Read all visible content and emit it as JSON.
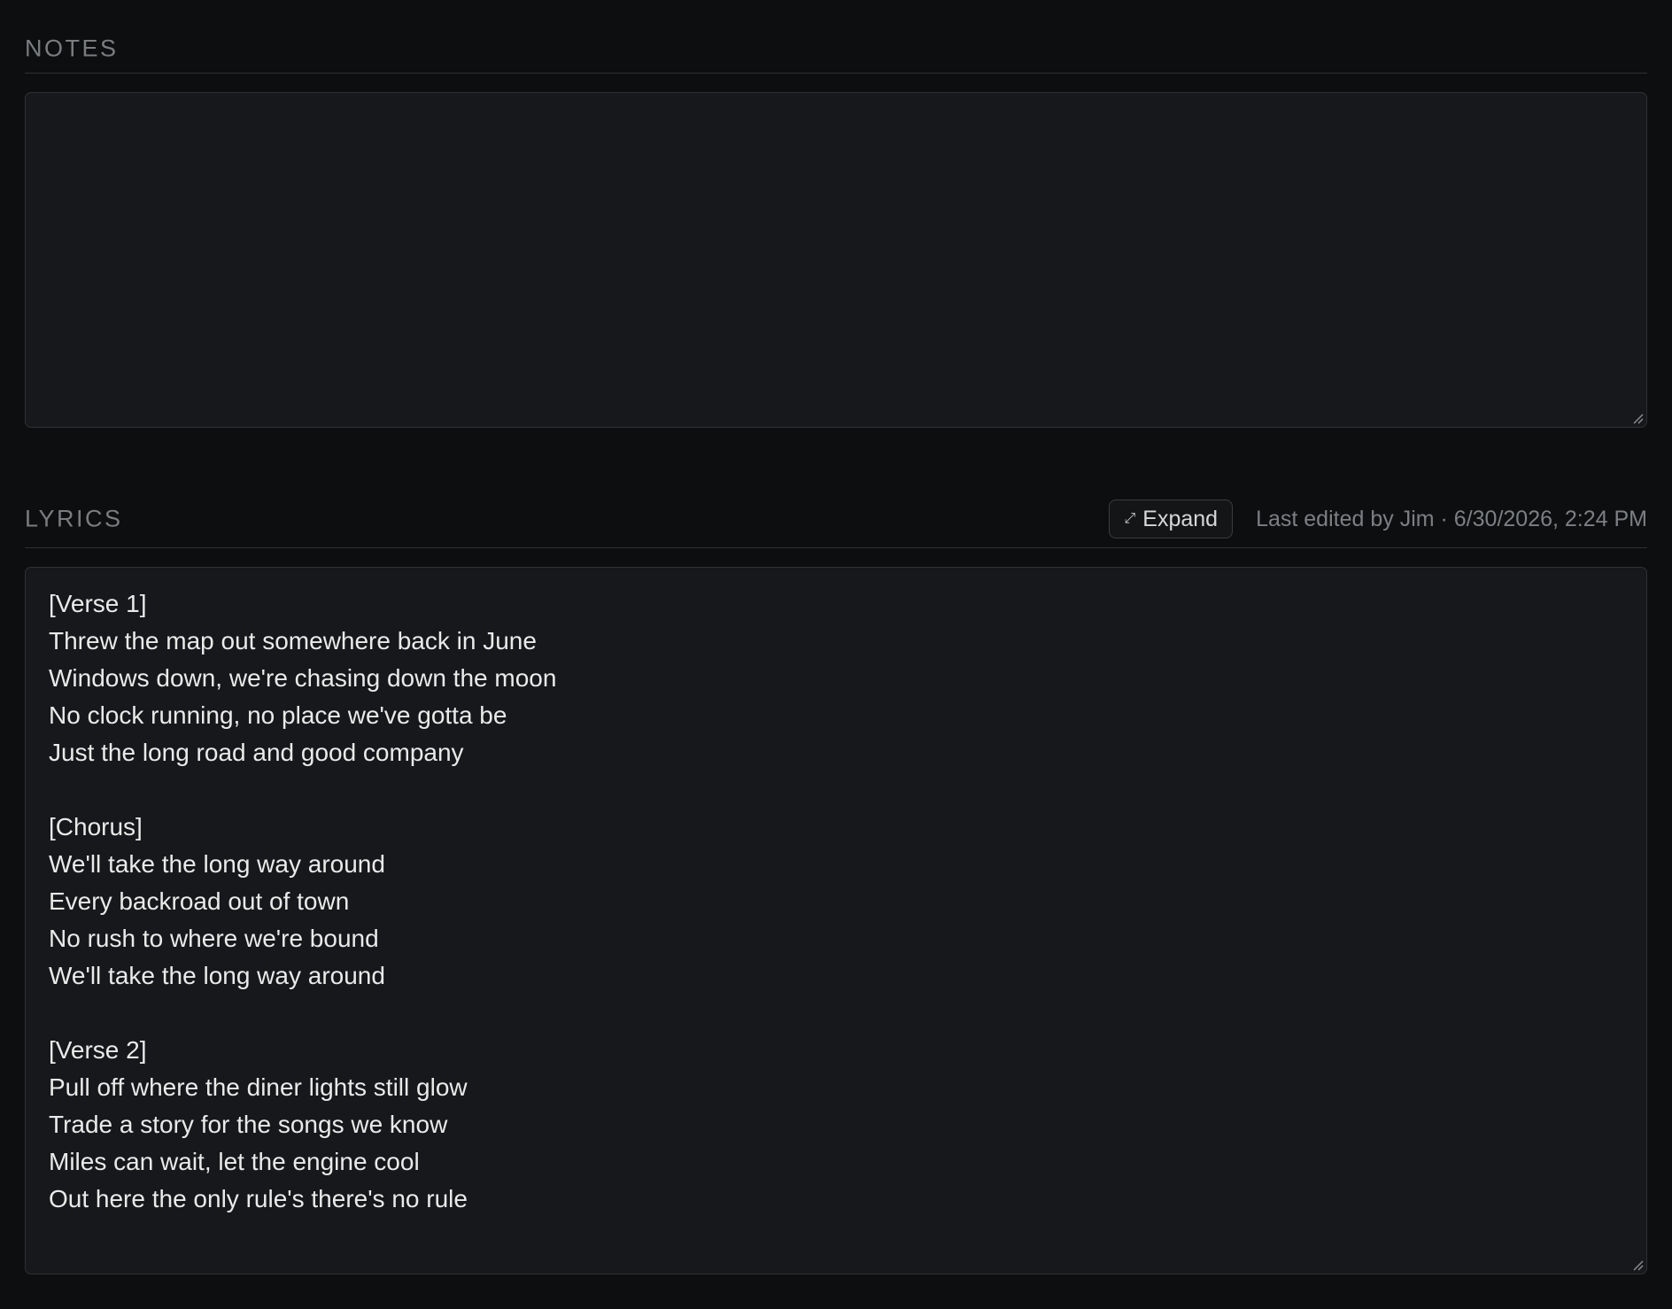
{
  "notes": {
    "title": "NOTES",
    "value": ""
  },
  "lyrics": {
    "title": "LYRICS",
    "expand_label": "Expand",
    "expand_icon": "expand-arrows-icon",
    "last_edited": "Last edited by Jim · 6/30/2026, 2:24 PM",
    "lines": [
      "[Verse 1]",
      "Threw the map out somewhere back in June",
      "Windows down, we're chasing down the moon",
      "No clock running, no place we've gotta be",
      "Just the long road and good company",
      "",
      "[Chorus]",
      "We'll take the long way around",
      "Every backroad out of town",
      "No rush to where we're bound",
      "We'll take the long way around",
      "",
      "[Verse 2]",
      "Pull off where the diner lights still glow",
      "Trade a story for the songs we know",
      "Miles can wait, let the engine cool",
      "Out here the only rule's there's no rule"
    ]
  }
}
